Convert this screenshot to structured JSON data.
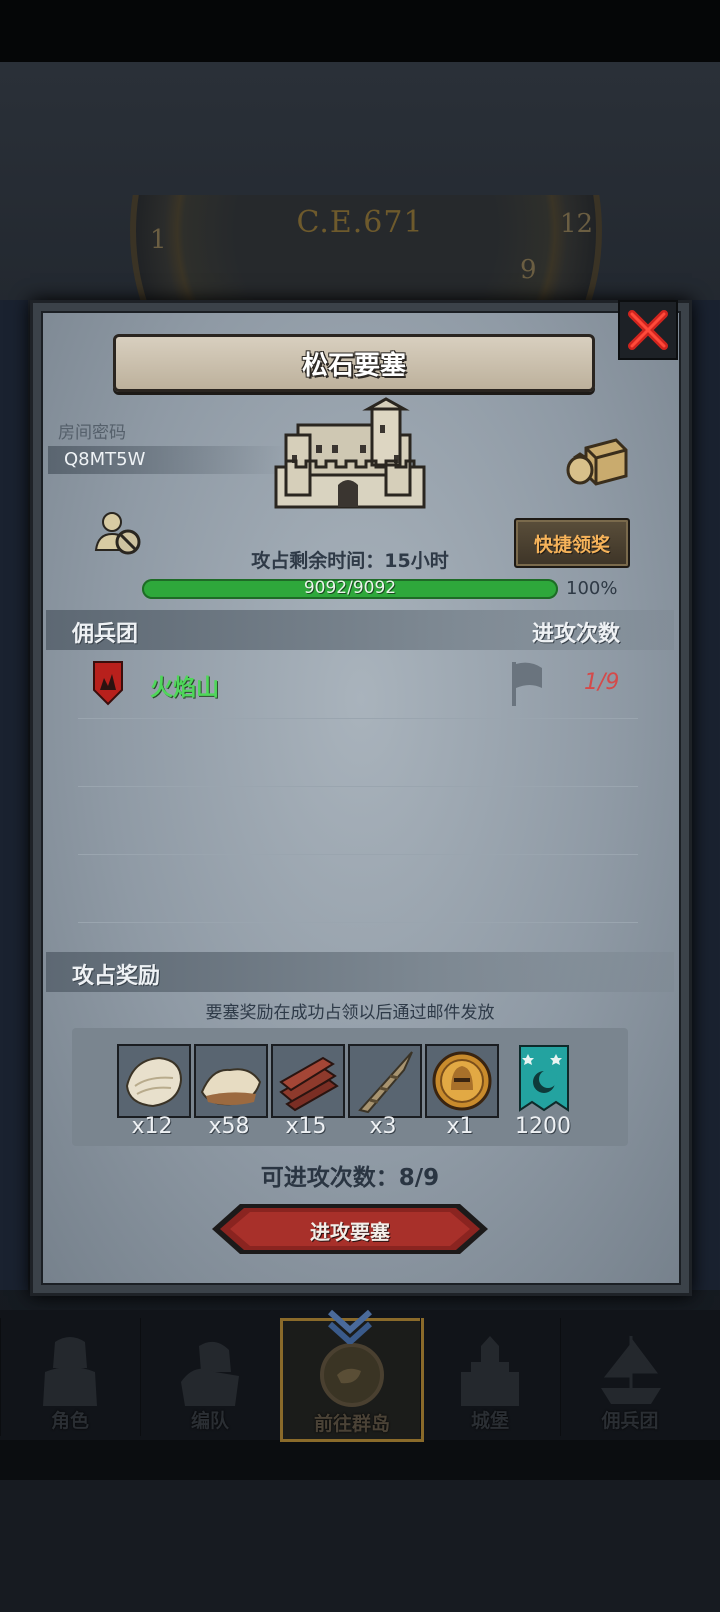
{
  "world": {
    "era": "C.E.671",
    "clock_marks": [
      "12",
      "1",
      "9"
    ]
  },
  "dialog": {
    "title": "松石要塞",
    "room_password_label": "房间密码",
    "room_password": "Q8MT5W",
    "quick_claim_label": "快捷领奖",
    "time_left_text": "攻占剩余时间：15小时",
    "hp_text": "9092/9092",
    "hp_fraction": 1.0,
    "hp_percent_text": "100%",
    "mercenary_header": "佣兵团",
    "attack_count_header": "进攻次数",
    "mercenaries": [
      {
        "name": "火焰山",
        "attacks": "1/9"
      }
    ],
    "reward_header": "攻占奖励",
    "reward_note": "要塞奖励在成功占领以后通过邮件发放",
    "rewards": [
      {
        "icon": "fur-pelt-icon",
        "qty": "x12"
      },
      {
        "icon": "wool-fleece-icon",
        "qty": "x58"
      },
      {
        "icon": "wood-planks-icon",
        "qty": "x15"
      },
      {
        "icon": "horn-icon",
        "qty": "x3"
      },
      {
        "icon": "knight-coin-icon",
        "qty": "x1"
      },
      {
        "icon": "guild-banner-icon",
        "qty": "1200"
      }
    ],
    "attacks_available_text": "可进攻次数：8/9",
    "attack_button_label": "进攻要塞"
  },
  "nav": [
    {
      "label": "角色",
      "icon": "knight-icon"
    },
    {
      "label": "编队",
      "icon": "formation-icon"
    },
    {
      "label": "前往群岛",
      "icon": "islands-icon",
      "active": true
    },
    {
      "label": "城堡",
      "icon": "castle-icon"
    },
    {
      "label": "佣兵团",
      "icon": "mercenary-ship-icon"
    }
  ],
  "colors": {
    "hp_green": "#2ea83b",
    "merc_name_green": "#4fd75a",
    "count_red": "#d44a4a",
    "quick_claim_orange": "#f6b35a"
  }
}
